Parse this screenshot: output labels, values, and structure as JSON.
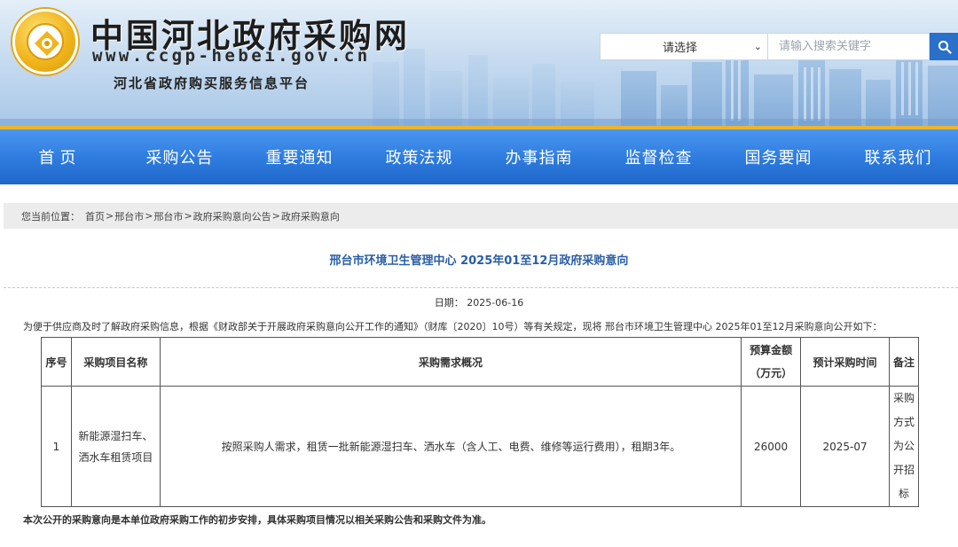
{
  "site": {
    "title": "中国河北政府采购网",
    "url": "www.ccgp-hebei.gov.cn",
    "subtitle": "河北省政府购买服务信息平台"
  },
  "search": {
    "select_value": "请选择",
    "placeholder": "请输入搜索关键字",
    "button_icon": "search-icon"
  },
  "nav": {
    "items": [
      {
        "label": "首页"
      },
      {
        "label": "采购公告"
      },
      {
        "label": "重要通知"
      },
      {
        "label": "政策法规"
      },
      {
        "label": "办事指南"
      },
      {
        "label": "监督检查"
      },
      {
        "label": "国务要闻"
      },
      {
        "label": "联系我们"
      }
    ]
  },
  "breadcrumb": {
    "prefix": "您当前位置：",
    "items": [
      "首页",
      "邢台市",
      "邢台市",
      "政府采购意向公告",
      "政府采购意向"
    ],
    "separator": ">"
  },
  "article": {
    "title": "邢台市环境卫生管理中心 2025年01至12月政府采购意向",
    "date_label": "日期：",
    "date_value": "2025-06-16",
    "intro": "为便于供应商及时了解政府采购信息，根据《财政部关于开展政府采购意向公开工作的通知》（财库〔2020〕10号）等有关规定，现将 邢台市环境卫生管理中心 2025年01至12月采购意向公开如下：",
    "footnote": "本次公开的采购意向是本单位政府采购工作的初步安排，具体采购项目情况以相关采购公告和采购文件为准。"
  },
  "table": {
    "headers": {
      "no": "序号",
      "name": "采购项目名称",
      "desc": "采购需求概况",
      "budget": "预算金额（万元）",
      "time": "预计采购时间",
      "note": "备注"
    },
    "rows": [
      {
        "no": "1",
        "name": "新能源湿扫车、洒水车租赁项目",
        "desc": "按照采购人需求，租赁一批新能源湿扫车、洒水车（含人工、电费、维修等运行费用），租期3年。",
        "budget": "26000",
        "time": "2025-07",
        "note": "采购方式为公开招标"
      }
    ]
  },
  "colors": {
    "nav_blue": "#2f7de0",
    "nav_accent": "#e9b52e",
    "title_blue": "#2a5ea6",
    "search_button": "#2a6fc9"
  }
}
